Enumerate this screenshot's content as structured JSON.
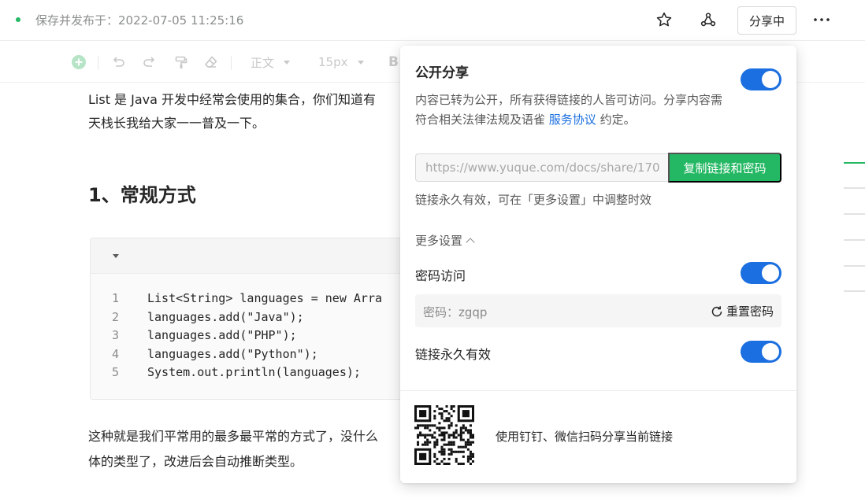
{
  "header": {
    "save_status": "保存并发布于：2022-07-05 11:25:16",
    "share_button": "分享中",
    "icons": [
      "star-icon",
      "share-network-icon",
      "more-icon"
    ]
  },
  "toolbar": {
    "text_style": "正文",
    "font_size": "15px",
    "bold": "B",
    "icons": [
      "add-circle-icon",
      "undo-icon",
      "redo-icon",
      "format-painter-icon",
      "eraser-icon"
    ]
  },
  "document": {
    "intro_line1": "List 是 Java 开发中经常会使用的集合，你们知道有",
    "intro_line2": "天栈长我给大家一一普及一下。",
    "heading": "1、常规方式",
    "code_lines": [
      {
        "num": "1",
        "text": "List<String> languages = new Arra"
      },
      {
        "num": "2",
        "text": "languages.add(\"Java\");"
      },
      {
        "num": "3",
        "text": "languages.add(\"PHP\");"
      },
      {
        "num": "4",
        "text": "languages.add(\"Python\");"
      },
      {
        "num": "5",
        "text": "System.out.println(languages);"
      }
    ],
    "outro_line1": "这种就是我们平常用的最多最平常的方式了，没什么",
    "outro_line2": "体的类型了，改进后会自动推断类型。"
  },
  "share_popover": {
    "title": "公开分享",
    "description_part1": "内容已转为公开，所有获得链接的人皆可访问。分享内容需符合相关法律法规及语雀",
    "agreement_link": "服务协议",
    "description_part2": "约定。",
    "url": "https://www.yuque.com/docs/share/170",
    "copy_button": "复制链接和密码",
    "hint": "链接永久有效，可在「更多设置」中调整时效",
    "more_settings": "更多设置",
    "password_access_label": "密码访问",
    "password_text": "密码：zgqp",
    "reset_password": "重置密码",
    "permanent_link_label": "链接永久有效",
    "qr_text": "使用钉钉、微信扫码分享当前链接",
    "toggles": {
      "public_share": true,
      "password_access": true,
      "permanent_link": true
    }
  },
  "colors": {
    "accent_green": "#25b864",
    "toggle_blue": "#1b6fe0",
    "link_blue": "#1b6fe0"
  }
}
